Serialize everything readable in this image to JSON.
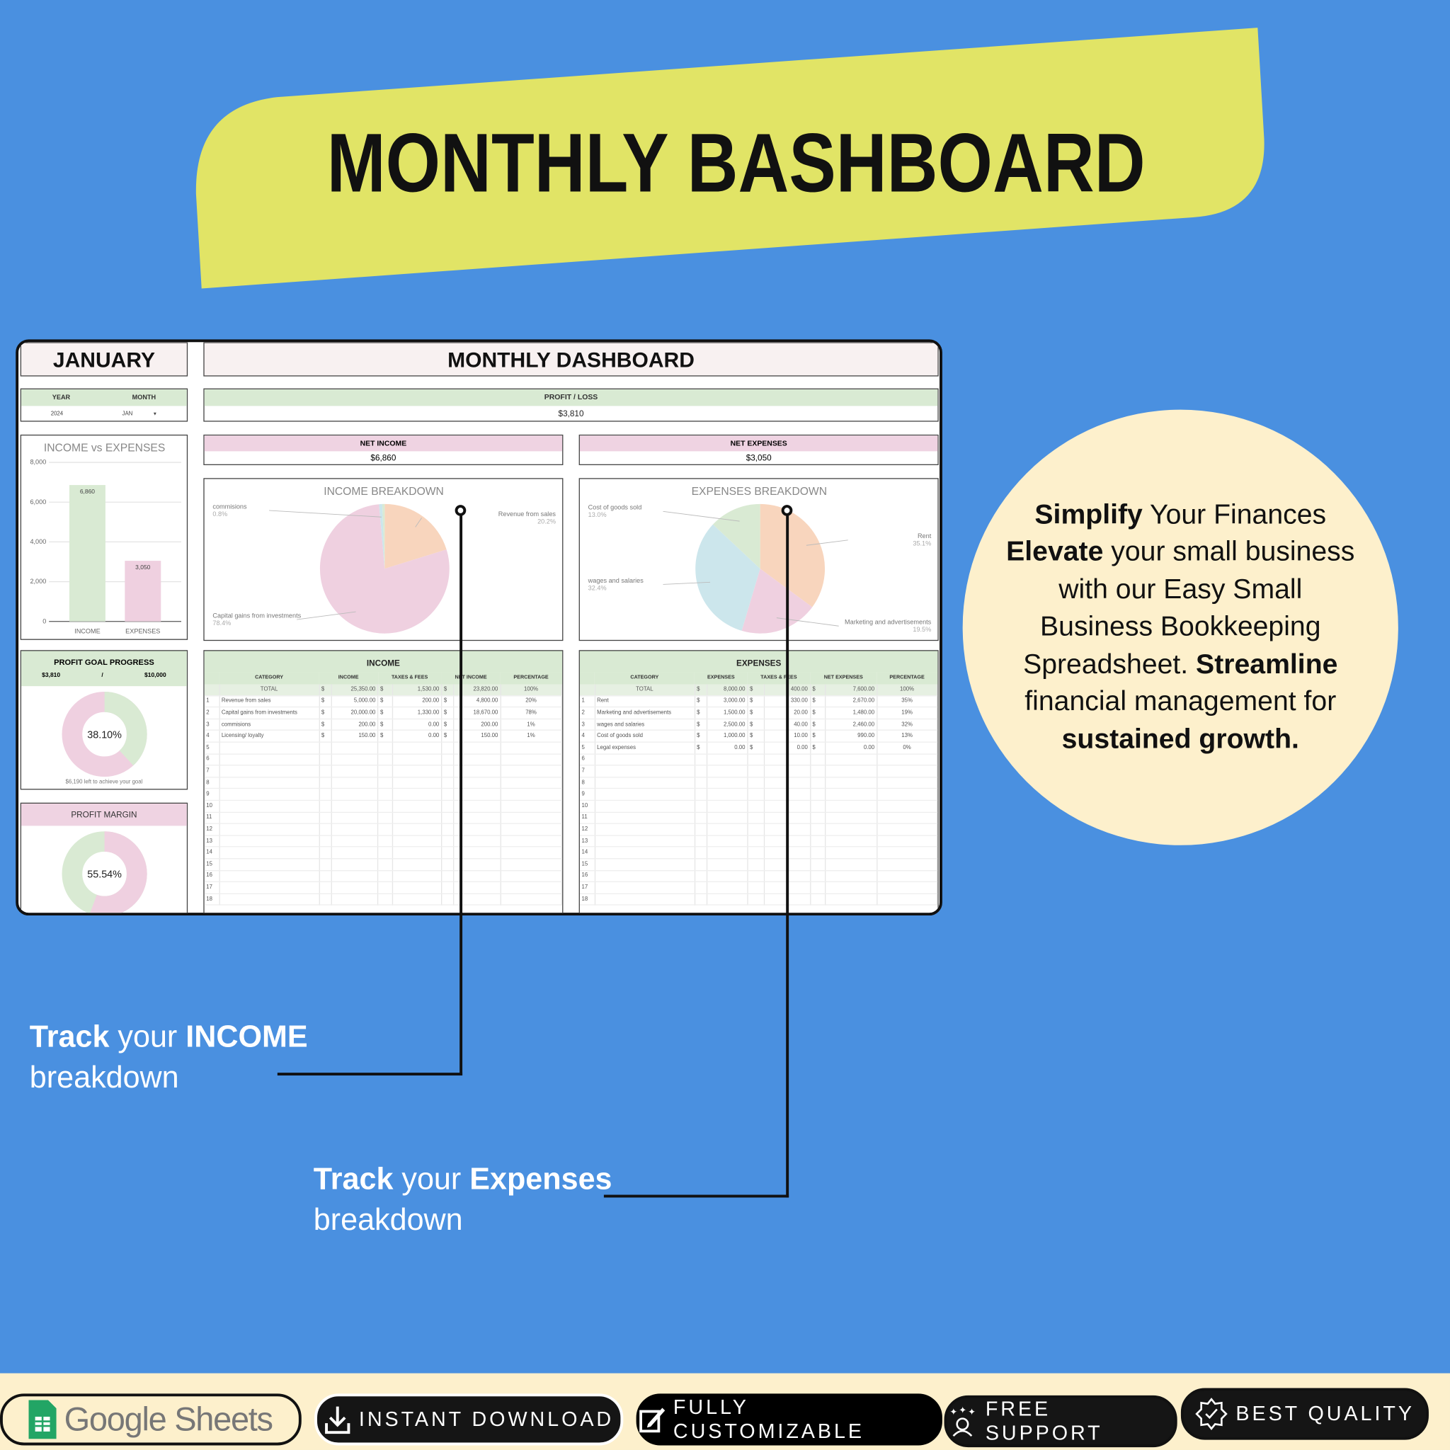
{
  "banner": {
    "title": "MONTHLY BASHBOARD",
    "color": "#e1e466"
  },
  "dashboard": {
    "month_title": "JANUARY",
    "title": "MONTHLY DASHBOARD",
    "year_label": "YEAR",
    "month_label": "MONTH",
    "year_value": "2024",
    "month_value": "JAN",
    "profit_loss_label": "PROFIT / LOSS",
    "profit_loss_value": "$3,810",
    "net_income_label": "NET INCOME",
    "net_income_value": "$6,860",
    "net_expenses_label": "NET EXPENSES",
    "net_expenses_value": "$3,050",
    "profit_goal": {
      "title": "PROFIT GOAL PROGRESS",
      "current": "$3,810",
      "separator": "/",
      "goal": "$10,000",
      "percent_label": "38.10%",
      "percent": 38.1,
      "left_text": "$6,190  left to achieve your goal"
    },
    "profit_margin": {
      "title": "PROFIT MARGIN",
      "percent_label": "55.54%",
      "percent": 55.54
    },
    "income_table": {
      "title": "INCOME",
      "columns": [
        "CATEGORY",
        "INCOME",
        "TAXES & FEES",
        "NET INCOME",
        "PERCENTAGE"
      ],
      "total": [
        "TOTAL",
        "25,350.00",
        "1,530.00",
        "23,820.00",
        "100%"
      ],
      "rows": [
        [
          "1",
          "Revenue from sales",
          "5,000.00",
          "200.00",
          "4,800.00",
          "20%"
        ],
        [
          "2",
          "Capital gains from investments",
          "20,000.00",
          "1,330.00",
          "18,670.00",
          "78%"
        ],
        [
          "3",
          "commisions",
          "200.00",
          "0.00",
          "200.00",
          "1%"
        ],
        [
          "4",
          "Licensing/ loyalty",
          "150.00",
          "0.00",
          "150.00",
          "1%"
        ]
      ],
      "empty_row_numbers": [
        "5",
        "6",
        "7",
        "8",
        "9",
        "10",
        "11",
        "12",
        "13",
        "14",
        "15",
        "16",
        "17",
        "18"
      ]
    },
    "expenses_table": {
      "title": "EXPENSES",
      "columns": [
        "CATEGORY",
        "EXPENSES",
        "TAXES & FEES",
        "NET EXPENSES",
        "PERCENTAGE"
      ],
      "total": [
        "TOTAL",
        "8,000.00",
        "400.00",
        "7,600.00",
        "100%"
      ],
      "rows": [
        [
          "1",
          "Rent",
          "3,000.00",
          "330.00",
          "2,670.00",
          "35%"
        ],
        [
          "2",
          "Marketing and advertisements",
          "1,500.00",
          "20.00",
          "1,480.00",
          "19%"
        ],
        [
          "3",
          "wages and salaries",
          "2,500.00",
          "40.00",
          "2,460.00",
          "32%"
        ],
        [
          "4",
          "Cost of goods sold",
          "1,000.00",
          "10.00",
          "990.00",
          "13%"
        ],
        [
          "5",
          "Legal expenses",
          "0.00",
          "0.00",
          "0.00",
          "0%"
        ]
      ],
      "empty_row_numbers": [
        "6",
        "7",
        "8",
        "9",
        "10",
        "11",
        "12",
        "13",
        "14",
        "15",
        "16",
        "17",
        "18"
      ]
    },
    "currency_symbol": "$"
  },
  "chart_data": [
    {
      "type": "bar",
      "title": "INCOME vs EXPENSES",
      "categories": [
        "INCOME",
        "EXPENSES"
      ],
      "values": [
        6860,
        3050
      ],
      "data_labels": [
        "6,860",
        "3,050"
      ],
      "ylim": [
        0,
        8000
      ],
      "yticks": [
        "0",
        "2,000",
        "4,000",
        "6,000",
        "8,000"
      ],
      "grid": true,
      "colors": [
        "#d9ead3",
        "#efd0e0"
      ]
    },
    {
      "type": "pie",
      "title": "INCOME BREAKDOWN",
      "slices": [
        {
          "name": "Revenue from sales",
          "value": 20.2,
          "label": "20.2%",
          "color": "#f8d5bd"
        },
        {
          "name": "Capital gains from investments",
          "value": 78.4,
          "label": "78.4%",
          "color": "#efd0e0"
        },
        {
          "name": "commisions",
          "value": 0.8,
          "label": "0.8%",
          "color": "#cce6ec"
        },
        {
          "value": 0.6,
          "color": "#d9ead3"
        }
      ]
    },
    {
      "type": "pie",
      "title": "EXPENSES BREAKDOWN",
      "slices": [
        {
          "name": "Rent",
          "value": 35.1,
          "label": "35.1%",
          "color": "#f8d5bd"
        },
        {
          "name": "Marketing and advertisements",
          "value": 19.5,
          "label": "19.5%",
          "color": "#efd0e0"
        },
        {
          "name": "wages and salaries",
          "value": 32.4,
          "label": "32.4%",
          "color": "#cce6ec"
        },
        {
          "name": "Cost of goods sold",
          "value": 13.0,
          "label": "13.0%",
          "color": "#d9ead3"
        }
      ]
    }
  ],
  "promo": {
    "line1_bold": "Simplify",
    "line1_rest": " Your Finances",
    "line2_bold": "Elevate",
    "line2_rest": " your small business with our Easy Small Business Bookkeeping Spreadsheet. ",
    "line3_bold": "Streamline",
    "line3_rest": " financial management for ",
    "line4_bold": "sustained growth."
  },
  "callouts": {
    "income": {
      "bold1": "Track",
      "mid": " your ",
      "bold2": "INCOME",
      "line2": "breakdown"
    },
    "expenses": {
      "bold1": "Track",
      "mid": " your ",
      "bold2": "Expenses",
      "line2": "breakdown"
    }
  },
  "badges": [
    {
      "label": "Google Sheets",
      "icon": "google-sheets-icon"
    },
    {
      "label": "INSTANT DOWNLOAD",
      "icon": "download-icon"
    },
    {
      "label": "FULLY CUSTOMIZABLE",
      "icon": "edit-icon"
    },
    {
      "label": "FREE SUPPORT",
      "icon": "support-icon"
    },
    {
      "label": "BEST QUALITY",
      "icon": "quality-badge-icon"
    }
  ]
}
